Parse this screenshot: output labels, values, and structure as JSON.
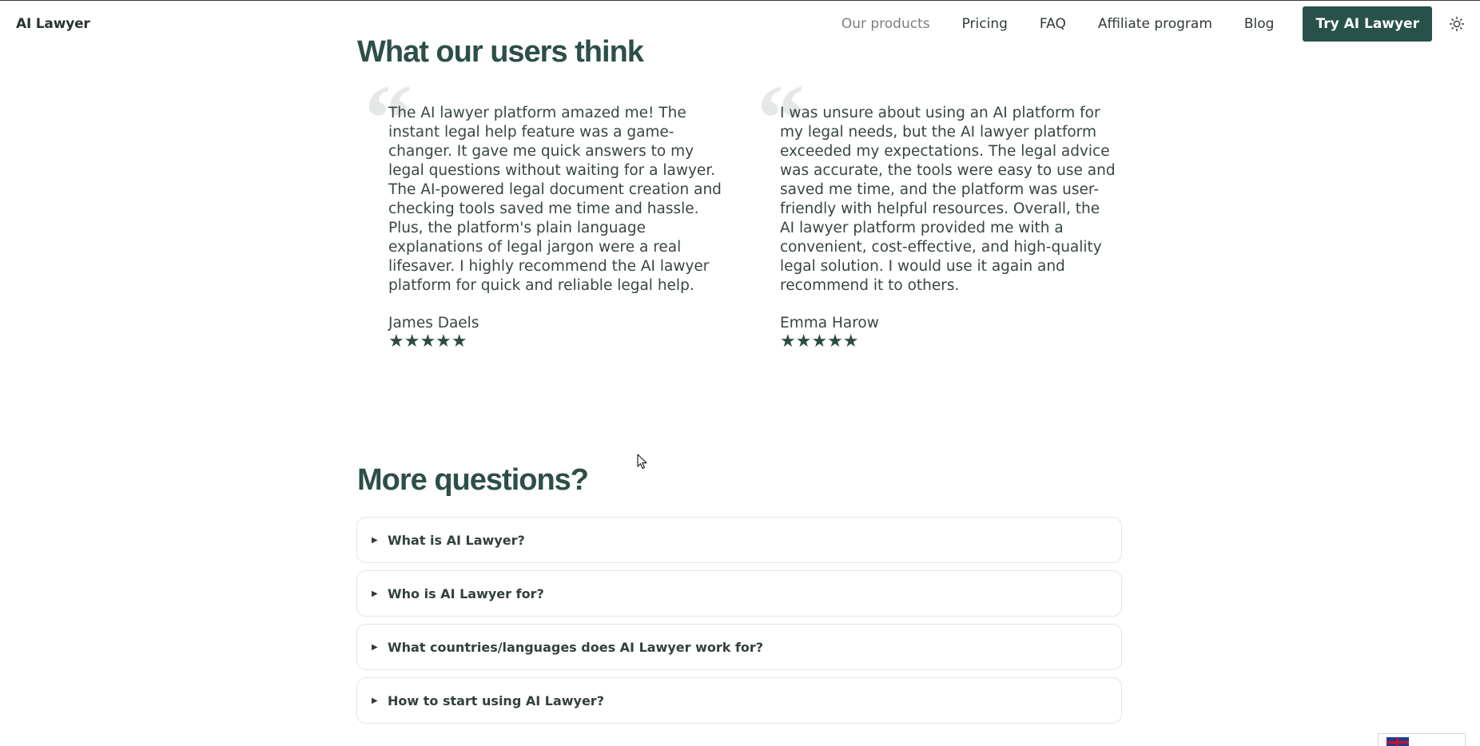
{
  "brand": "AI Lawyer",
  "nav": {
    "links": [
      "Our products",
      "Pricing",
      "FAQ",
      "Affiliate program",
      "Blog"
    ],
    "cta": "Try AI Lawyer",
    "theme_icon": "sun-icon"
  },
  "testimonials": {
    "title": "What our users think",
    "items": [
      {
        "text": "The AI lawyer platform amazed me! The instant legal help feature was a game-changer. It gave me quick answers to my legal questions without waiting for a lawyer. The AI-powered legal document creation and checking tools saved me time and hassle. Plus, the platform's plain language explanations of legal jargon were a real lifesaver. I highly recommend the AI lawyer platform for quick and reliable legal help.",
        "name": "James Daels",
        "rating": 5,
        "stars": "★★★★★"
      },
      {
        "text": "I was unsure about using an AI platform for my legal needs, but the AI lawyer platform exceeded my expectations. The legal advice was accurate, the tools were easy to use and saved me time, and the platform was user-friendly with helpful resources. Overall, the AI lawyer platform provided me with a convenient, cost-effective, and high-quality legal solution. I would use it again and recommend it to others.",
        "name": "Emma Harow",
        "rating": 5,
        "stars": "★★★★★"
      }
    ]
  },
  "faq": {
    "title": "More questions?",
    "items": [
      "What is AI Lawyer?",
      "Who is AI Lawyer for?",
      "What countries/languages does AI Lawyer work for?",
      "How to start using AI Lawyer?"
    ]
  },
  "colors": {
    "accent": "#28514a",
    "heading": "#2c4f48",
    "text": "#394642"
  }
}
